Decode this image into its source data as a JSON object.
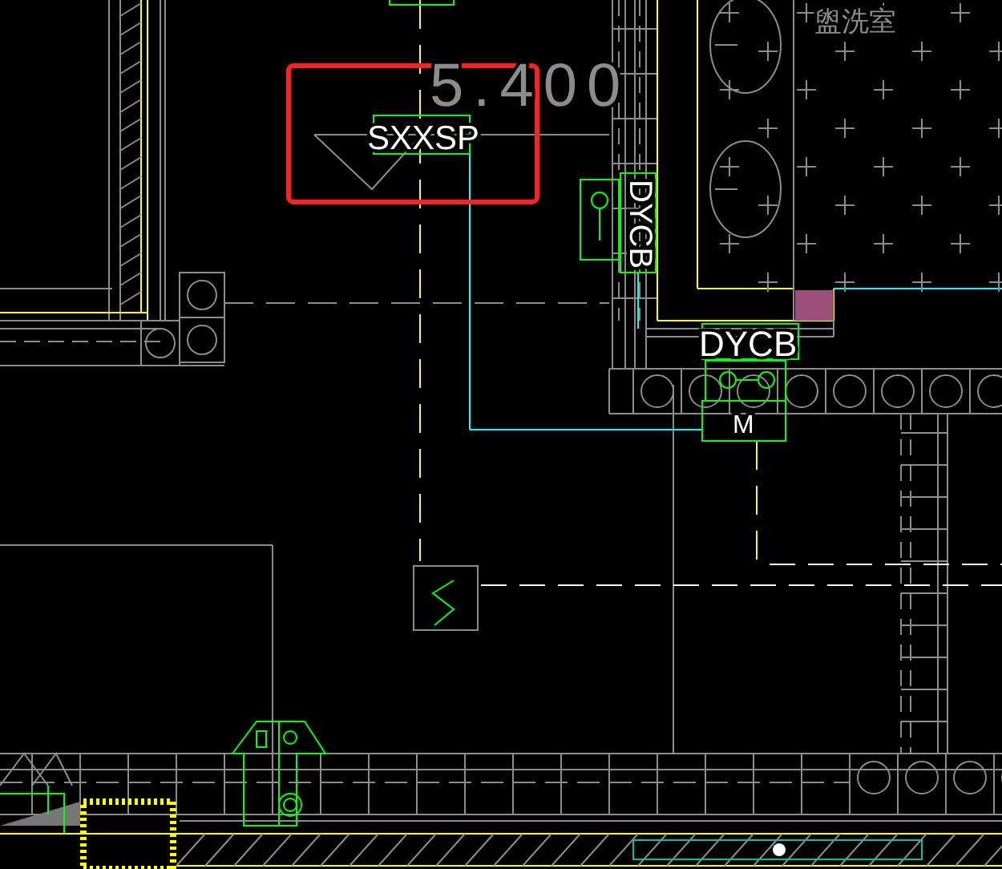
{
  "drawing": {
    "elevation_mark": "5.400",
    "pipe_tag": "SXXSP",
    "vertical_tag": "DYCB",
    "box_tag": "DYCB",
    "motor_label": "M",
    "room_name": "盥洗室"
  }
}
